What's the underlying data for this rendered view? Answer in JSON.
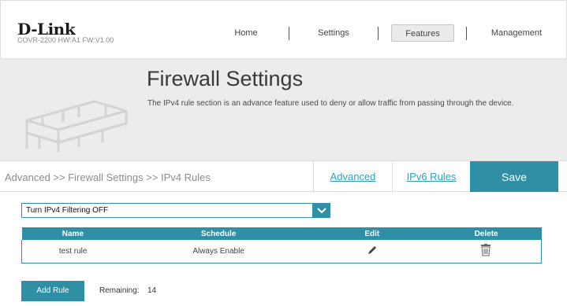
{
  "header": {
    "logo": "D-Link",
    "model": "COVR-2200 HW:A1 FW:V1.00",
    "nav": [
      {
        "label": "Home"
      },
      {
        "label": "Settings"
      },
      {
        "label": "Features",
        "active": true
      },
      {
        "label": "Management"
      }
    ]
  },
  "banner": {
    "title": "Firewall Settings",
    "description": "The IPv4 rule section is an advance feature used to deny or allow traffic from passing through the device.",
    "icon": "brick-wall-icon"
  },
  "breadcrumb": "Advanced >> Firewall Settings >> IPv4 Rules",
  "tabs": {
    "advanced": "Advanced",
    "ipv6": "IPv6 Rules",
    "save": "Save"
  },
  "filter": {
    "selected": "Turn IPv4 Filtering OFF"
  },
  "table": {
    "headers": [
      "Name",
      "Schedule",
      "Edit",
      "Delete"
    ],
    "rows": [
      {
        "name": "test rule",
        "schedule": "Always Enable",
        "edit_icon": "pencil-icon",
        "delete_icon": "trash-icon"
      }
    ]
  },
  "footer": {
    "add_button": "Add Rule",
    "remaining_label": "Remaining:",
    "remaining_count": "14"
  },
  "colors": {
    "accent": "#2e8fa5",
    "link": "#2aa3bf"
  }
}
